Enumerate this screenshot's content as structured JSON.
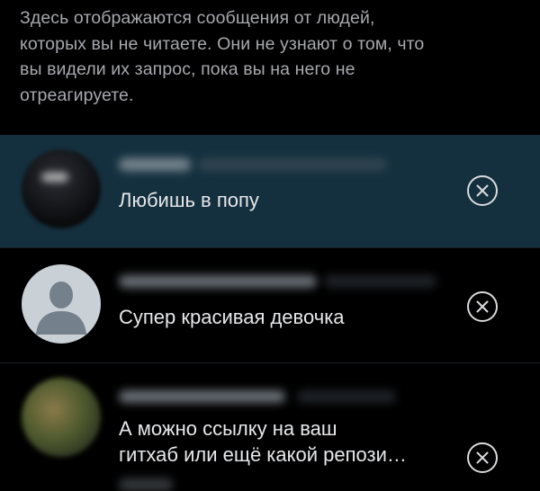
{
  "info": {
    "lines": [
      "Здесь отображаются сообщения от людей,",
      "которых вы не читаете. Они не узнают о том, что",
      "вы видели их запрос, пока вы на него не",
      "отреагируете."
    ]
  },
  "requests": [
    {
      "message": "Любишь в попу",
      "dismiss_icon": "close-circle-icon"
    },
    {
      "message": "Супер красивая девочка",
      "avatar_icon": "default-avatar-icon",
      "dismiss_icon": "close-circle-icon"
    },
    {
      "message_lines": [
        "А можно ссылку на ваш",
        "гитхаб или ещё какой репози…"
      ],
      "dismiss_icon": "close-circle-icon"
    }
  ],
  "colors": {
    "background": "#000000",
    "selected_row": "#14303e",
    "info_text": "#a7a8ad",
    "message_text": "#e6e7ea",
    "default_avatar": "#c9d0d6",
    "default_avatar_figure": "#74808b"
  }
}
